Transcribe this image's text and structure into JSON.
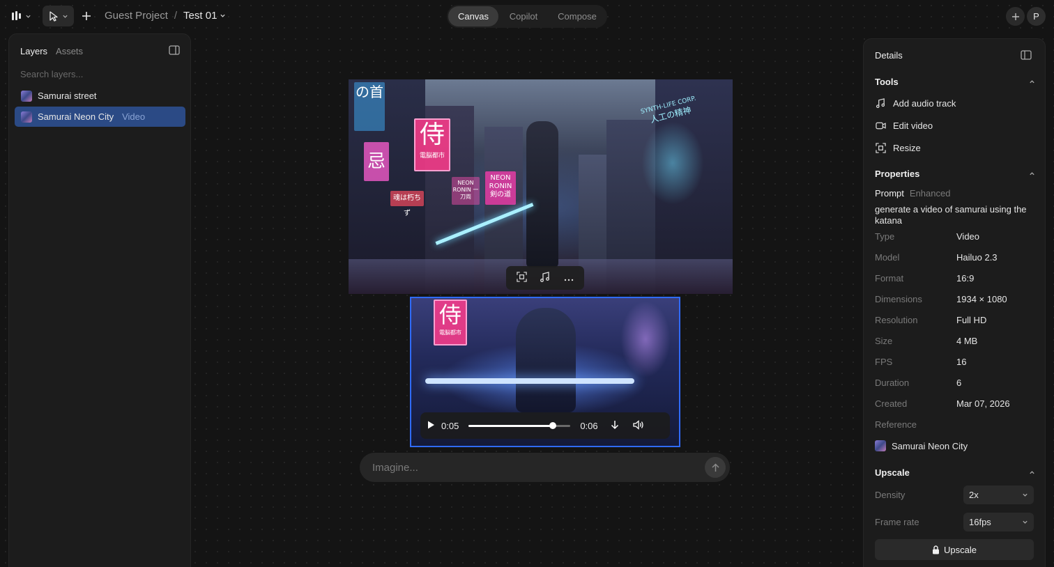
{
  "topbar": {
    "logo_icon": "logo-icon",
    "project_name": "Guest Project",
    "separator": "/",
    "file_name": "Test 01",
    "tabs": [
      {
        "label": "Canvas",
        "active": true
      },
      {
        "label": "Copilot",
        "active": false
      },
      {
        "label": "Compose",
        "active": false
      }
    ],
    "avatar_initial": "P"
  },
  "left_panel": {
    "tabs": [
      {
        "label": "Layers",
        "active": true
      },
      {
        "label": "Assets",
        "active": false
      }
    ],
    "search_placeholder": "Search layers...",
    "layers": [
      {
        "name": "Samurai street",
        "type": "",
        "selected": false
      },
      {
        "name": "Samurai Neon City",
        "type": "Video",
        "selected": true
      }
    ]
  },
  "canvas": {
    "image": {
      "signs": [
        "侍",
        "電脳都市",
        "NEON RONIN",
        "剣の道",
        "SYNTH-LIFE CORP.",
        "人工の精神",
        "魂は朽ちず",
        "NEON RONIN 一刀両",
        "の首",
        "忌"
      ]
    },
    "video": {
      "current_time": "0:05",
      "duration": "0:06",
      "progress": 0.83,
      "signs": [
        "侍",
        "電脳都市"
      ]
    },
    "prompt_placeholder": "Imagine..."
  },
  "right_panel": {
    "title": "Details",
    "tools": {
      "title": "Tools",
      "items": [
        {
          "label": "Add audio track",
          "icon": "audio-track-icon"
        },
        {
          "label": "Edit video",
          "icon": "video-camera-icon"
        },
        {
          "label": "Resize",
          "icon": "resize-icon"
        }
      ]
    },
    "properties": {
      "title": "Properties",
      "prompt_label": "Prompt",
      "prompt_sub": "Enhanced",
      "prompt_text": "generate a video of samurai using the katana",
      "rows": [
        {
          "key": "Type",
          "value": "Video"
        },
        {
          "key": "Model",
          "value": "Hailuo 2.3"
        },
        {
          "key": "Format",
          "value": "16:9"
        },
        {
          "key": "Dimensions",
          "value": "1934 × 1080"
        },
        {
          "key": "Resolution",
          "value": "Full HD"
        },
        {
          "key": "Size",
          "value": "4 MB"
        },
        {
          "key": "FPS",
          "value": "16"
        },
        {
          "key": "Duration",
          "value": "6"
        },
        {
          "key": "Created",
          "value": "Mar 07, 2026"
        },
        {
          "key": "Reference",
          "value": ""
        }
      ],
      "reference_name": "Samurai Neon City"
    },
    "upscale": {
      "title": "Upscale",
      "density_label": "Density",
      "density_value": "2x",
      "frame_rate_label": "Frame rate",
      "frame_rate_value": "16fps",
      "button_label": "Upscale"
    }
  }
}
